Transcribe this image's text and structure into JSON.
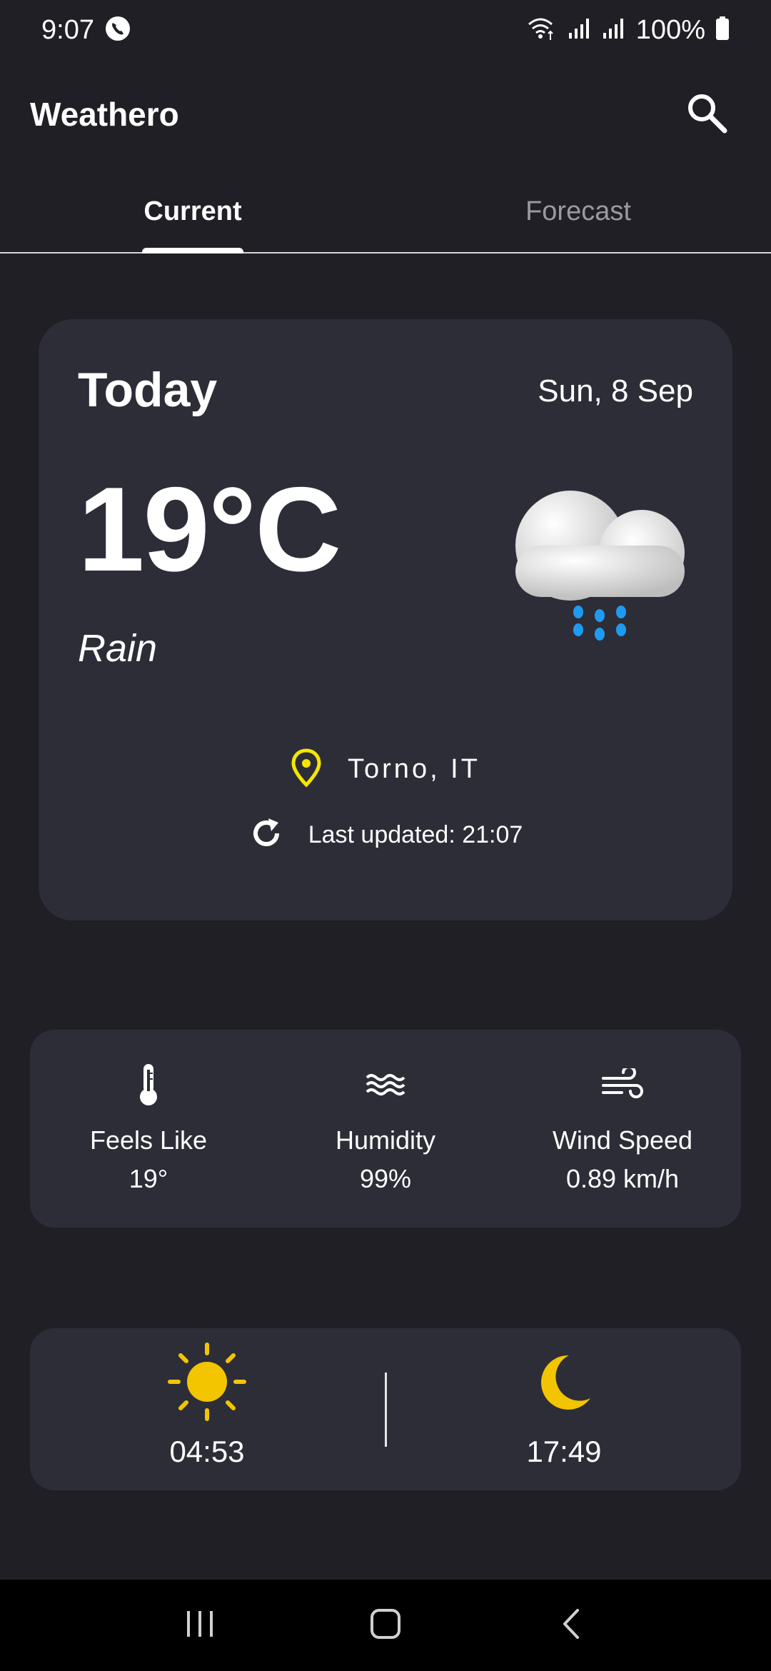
{
  "status_bar": {
    "time": "9:07",
    "battery": "100%"
  },
  "app_bar": {
    "title": "Weathero"
  },
  "tabs": [
    {
      "label": "Current",
      "active": true
    },
    {
      "label": "Forecast",
      "active": false
    }
  ],
  "weather_card": {
    "day_label": "Today",
    "date": "Sun, 8 Sep",
    "temperature": "19°C",
    "condition": "Rain",
    "location": "Torno, IT",
    "last_updated": "Last updated: 21:07"
  },
  "details": [
    {
      "label": "Feels Like",
      "value": "19°",
      "icon": "thermometer-icon"
    },
    {
      "label": "Humidity",
      "value": "99%",
      "icon": "waves-icon"
    },
    {
      "label": "Wind Speed",
      "value": "0.89 km/h",
      "icon": "wind-icon"
    }
  ],
  "sun": {
    "sunrise": "04:53",
    "sunset": "17:49"
  },
  "colors": {
    "background": "#1f1f25",
    "card": "#2d2d38",
    "accent_yellow": "#f2c500",
    "location_pin": "#f5e600",
    "rain_drops": "#1e9bf0"
  }
}
